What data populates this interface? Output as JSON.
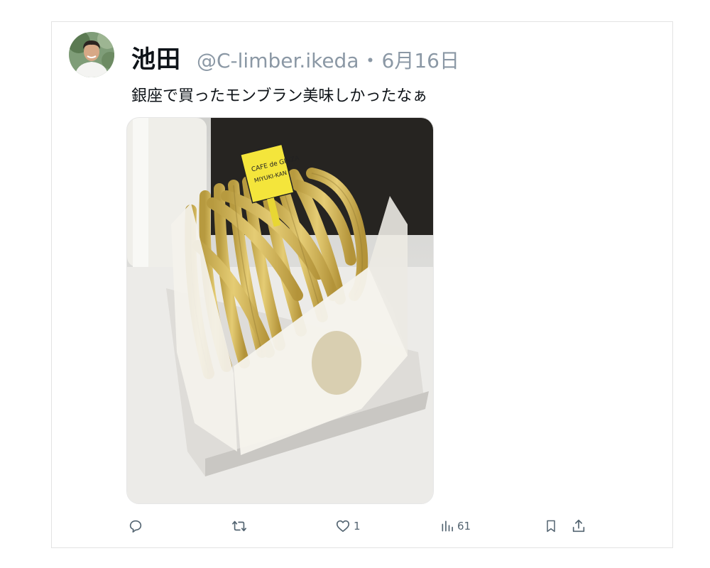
{
  "tweet": {
    "author_name": "池田",
    "handle": "@C-limber.ikeda",
    "separator": "・",
    "date": "6月16日",
    "text": "銀座で買ったモンブラン美味しかったなぁ",
    "avatar_icon": "user-avatar-photo",
    "media_description_icon": "montblanc-cake-photo",
    "pick_label_line1": "CAFE de GINZA",
    "pick_label_line2": "MIYUKI-KAN"
  },
  "actions": {
    "reply": {
      "icon": "reply-icon",
      "count": ""
    },
    "retweet": {
      "icon": "retweet-icon",
      "count": ""
    },
    "like": {
      "icon": "heart-icon",
      "count": "1"
    },
    "views": {
      "icon": "views-chart-icon",
      "count": "61"
    },
    "bookmark": {
      "icon": "bookmark-icon",
      "count": ""
    },
    "share": {
      "icon": "share-icon",
      "count": ""
    }
  },
  "colors": {
    "text_primary": "#0f1419",
    "text_secondary": "#8b98a5",
    "icon_gray": "#536471",
    "border": "#e3e3e3",
    "cream": "#d9c068"
  }
}
